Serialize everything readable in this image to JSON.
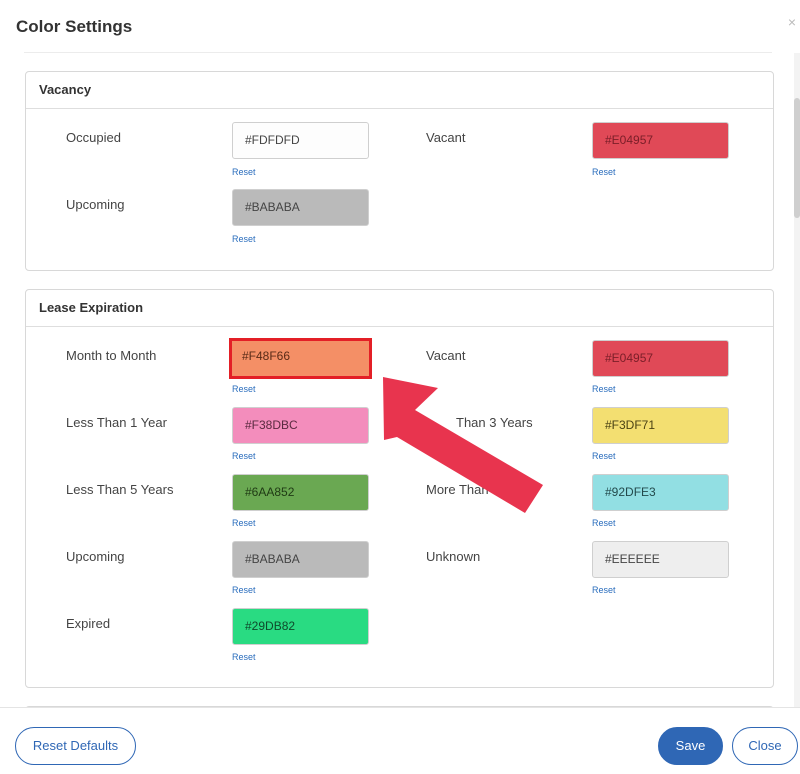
{
  "dialog": {
    "title": "Color Settings",
    "close_icon": "×"
  },
  "vacancy": {
    "title": "Vacancy",
    "items": [
      {
        "label": "Occupied",
        "value": "#FDFDFD",
        "color": "#FDFDFD",
        "text_color": "#444444",
        "reset": "Reset"
      },
      {
        "label": "Vacant",
        "value": "#E04957",
        "color": "#E04957",
        "text_color": "#7a1e28",
        "reset": "Reset"
      },
      {
        "label": "Upcoming",
        "value": "#BABABA",
        "color": "#BABABA",
        "text_color": "#444444",
        "reset": "Reset"
      }
    ]
  },
  "lease": {
    "title": "Lease Expiration",
    "items": [
      {
        "label": "Month to Month",
        "value": "#F48F66",
        "color": "#F48F66",
        "text_color": "#5a2b17",
        "reset": "Reset"
      },
      {
        "label": "Vacant",
        "value": "#E04957",
        "color": "#E04957",
        "text_color": "#7a1e28",
        "reset": "Reset"
      },
      {
        "label": "Less Than 1 Year",
        "value": "#F38DBC",
        "color": "#F38DBC",
        "text_color": "#5a2a40",
        "reset": "Reset"
      },
      {
        "label": "Than 3 Years",
        "value": "#F3DF71",
        "color": "#F3DF71",
        "text_color": "#4a4214",
        "reset": "Reset"
      },
      {
        "label": "Less Than 5 Years",
        "value": "#6AA852",
        "color": "#6AA852",
        "text_color": "#1f3a14",
        "reset": "Reset"
      },
      {
        "label": "More Than 5 Y",
        "value": "#92DFE3",
        "color": "#92DFE3",
        "text_color": "#234a4c",
        "reset": "Reset"
      },
      {
        "label": "Upcoming",
        "value": "#BABABA",
        "color": "#BABABA",
        "text_color": "#444444",
        "reset": "Reset"
      },
      {
        "label": "Unknown",
        "value": "#EEEEEE",
        "color": "#EEEEEE",
        "text_color": "#444444",
        "reset": "Reset"
      },
      {
        "label": "Expired",
        "value": "#29DB82",
        "color": "#29DB82",
        "text_color": "#0f4a2c",
        "reset": "Reset"
      }
    ]
  },
  "footer": {
    "reset_defaults": "Reset Defaults",
    "save": "Save",
    "close": "Close"
  },
  "colors": {
    "accent": "#2F67B5",
    "highlight": "#E31F26",
    "arrow": "#E8344E"
  }
}
